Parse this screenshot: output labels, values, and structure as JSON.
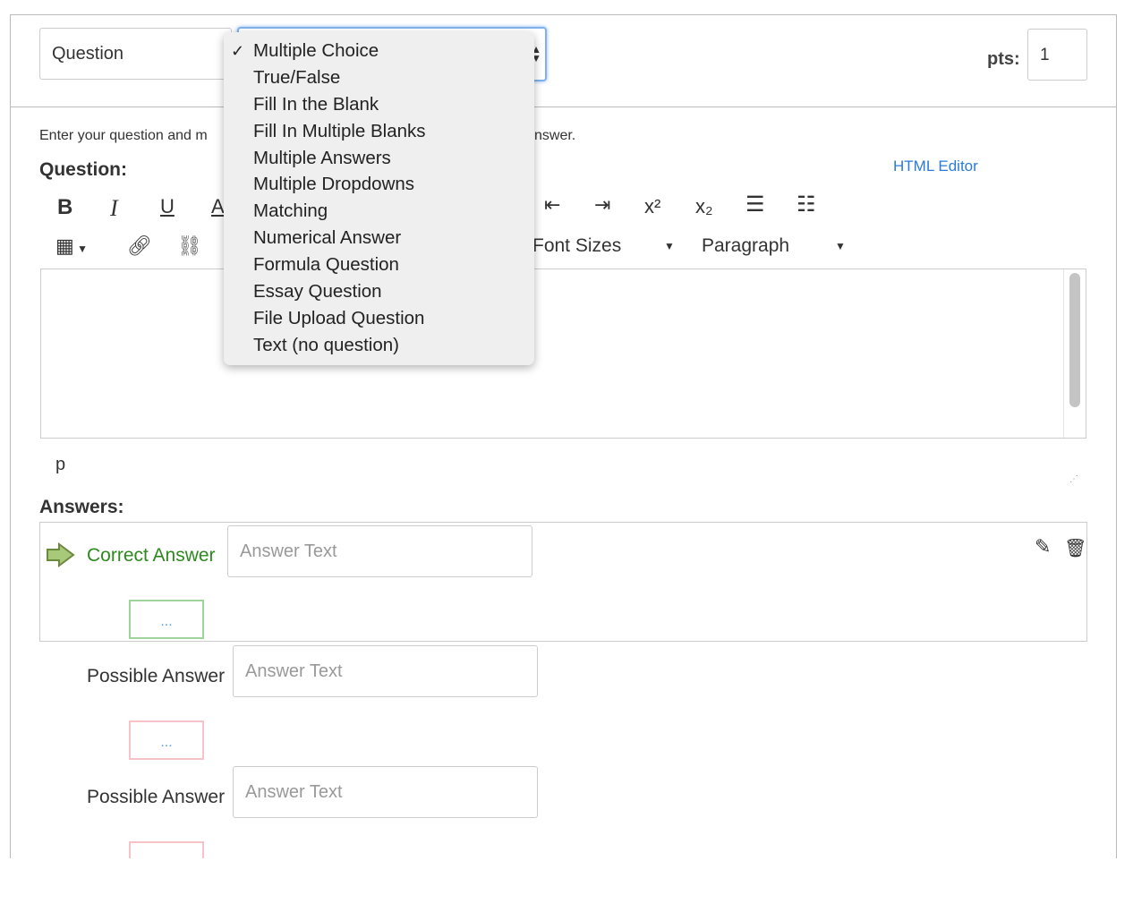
{
  "header": {
    "question_name": "Question",
    "question_type": {
      "selected": "Multiple Choice",
      "options": [
        "Multiple Choice",
        "True/False",
        "Fill In the Blank",
        "Fill In Multiple Blanks",
        "Multiple Answers",
        "Multiple Dropdowns",
        "Matching",
        "Numerical Answer",
        "Formula Question",
        "Essay Question",
        "File Upload Question",
        "Text (no question)"
      ]
    },
    "pts_label": "pts:",
    "pts_value": "1"
  },
  "body": {
    "instructions_visible_left": "Enter your question and m",
    "instructions_visible_right": "nswer.",
    "question_label": "Question:",
    "html_editor_link": "HTML Editor",
    "toolbar": {
      "bold": "B",
      "italic": "I",
      "underline": "U",
      "font_color": "A",
      "superscript": "x²",
      "subscript": "x₂",
      "font_sizes": "Font Sizes",
      "paragraph": "Paragraph"
    },
    "path_indicator": "p",
    "answers_label": "Answers:",
    "answers": [
      {
        "label": "Correct Answer",
        "placeholder": "Answer Text",
        "comment": "...",
        "type": "correct"
      },
      {
        "label": "Possible Answer",
        "placeholder": "Answer Text",
        "comment": "...",
        "type": "possible"
      },
      {
        "label": "Possible Answer",
        "placeholder": "Answer Text",
        "comment": "...",
        "type": "possible"
      }
    ]
  },
  "colors": {
    "correct": "#2d8a1e",
    "link": "#2b7bd6",
    "focus": "#7fb2ec",
    "correct_border": "#9ed39a",
    "wrong_border": "#f7c3c8"
  }
}
